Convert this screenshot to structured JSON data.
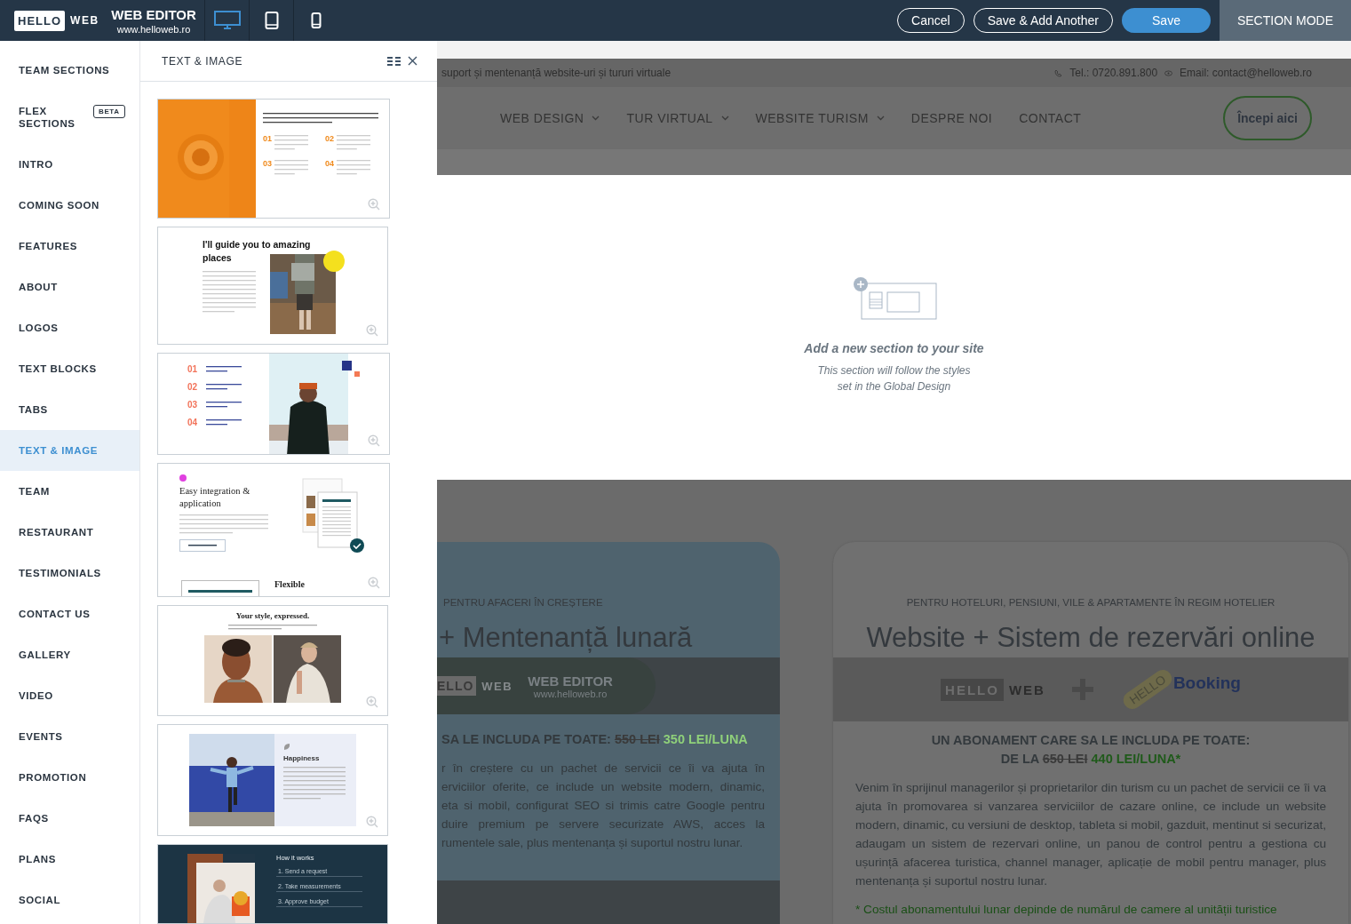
{
  "topbar": {
    "logo_hello": "HELLO",
    "logo_web": "WEB",
    "title": "WEB EDITOR",
    "url": "www.helloweb.ro",
    "devices": [
      {
        "kind": "desktop",
        "selected": true
      },
      {
        "kind": "tablet",
        "selected": false
      },
      {
        "kind": "phone",
        "selected": false
      }
    ],
    "buttons": [
      {
        "label": "Cancel",
        "kind": "outline"
      },
      {
        "label": "Save & Add Another",
        "kind": "outline"
      },
      {
        "label": "Save",
        "kind": "primary"
      }
    ],
    "mode": "SECTION MODE"
  },
  "sidebar": {
    "items": [
      {
        "label": "TEAM SECTIONS",
        "selected": false
      },
      {
        "label": "FLEX SECTIONS",
        "badge": "BETA",
        "selected": false
      },
      {
        "label": "INTRO",
        "selected": false
      },
      {
        "label": "COMING SOON",
        "selected": false
      },
      {
        "label": "FEATURES",
        "selected": false
      },
      {
        "label": "ABOUT",
        "selected": false
      },
      {
        "label": "LOGOS",
        "selected": false
      },
      {
        "label": "TEXT BLOCKS",
        "selected": false
      },
      {
        "label": "TABS",
        "selected": false
      },
      {
        "label": "TEXT & IMAGE",
        "selected": true
      },
      {
        "label": "TEAM",
        "selected": false
      },
      {
        "label": "RESTAURANT",
        "selected": false
      },
      {
        "label": "TESTIMONIALS",
        "selected": false
      },
      {
        "label": "CONTACT US",
        "selected": false
      },
      {
        "label": "GALLERY",
        "selected": false
      },
      {
        "label": "VIDEO",
        "selected": false
      },
      {
        "label": "EVENTS",
        "selected": false
      },
      {
        "label": "PROMOTION",
        "selected": false
      },
      {
        "label": "FAQS",
        "selected": false
      },
      {
        "label": "PLANS",
        "selected": false
      },
      {
        "label": "SOCIAL",
        "selected": false
      }
    ]
  },
  "panel": {
    "title": "TEXT & IMAGE",
    "templates": [
      {
        "kind": "numbered",
        "numbers": [
          "01",
          "02",
          "03",
          "04"
        ]
      },
      {
        "kind": "guide",
        "heading": "I'll guide you to amazing places"
      },
      {
        "kind": "values",
        "numbers": [
          "01",
          "02",
          "03",
          "04"
        ]
      },
      {
        "kind": "integration",
        "heading": "Easy integration & application",
        "subheading": "Flexible"
      },
      {
        "kind": "style",
        "heading": "Your style, expressed."
      },
      {
        "kind": "happiness",
        "heading": "Happiness"
      },
      {
        "kind": "how",
        "heading": "How it works",
        "steps": [
          "1. Send a request",
          "2. Take measurements",
          "3. Approve budget"
        ]
      }
    ]
  },
  "site": {
    "tagline": "suport și mentenanță website-uri și tururi virtuale",
    "phone": "Tel.: 0720.891.800",
    "email": "Email: contact@helloweb.ro",
    "nav": [
      {
        "label": "WEB DESIGN",
        "dropdown": true
      },
      {
        "label": "TUR VIRTUAL",
        "dropdown": true
      },
      {
        "label": "WEBSITE TURISM",
        "dropdown": true
      },
      {
        "label": "DESPRE NOI",
        "dropdown": false
      },
      {
        "label": "CONTACT",
        "dropdown": false
      }
    ],
    "cta": "Începi aici"
  },
  "empty_section": {
    "title": "Add a new section to your site",
    "lines": [
      "This section will follow the styles",
      "set in the Global Design"
    ]
  },
  "cards": [
    {
      "kind": "partial",
      "eyebrow": "PENTRU AFACERI ÎN CREȘTERE",
      "title": "+ Mentenanță lunară",
      "banner": {
        "kind": "editor",
        "hello": "ELLO",
        "web": "WEB",
        "title": "WEB EDITOR",
        "url": "www.helloweb.ro"
      },
      "lead": "SA LE INCLUDA PE TOATE:",
      "old_price": "550 LEI",
      "new_price": "350 LEI/LUNA",
      "body_lines": [
        "r în creștere cu un pachet de servicii ce îi va ajuta în",
        "erviciilor oferite, ce include un website modern, dinamic,",
        "eta si mobil, configurat SEO si trimis catre Google pentru",
        "duire premium pe servere securizate AWS, acces la",
        "rumentele sale, plus mentenanța și suportul nostru lunar."
      ]
    },
    {
      "kind": "full",
      "eyebrow": "PENTRU HOTELURI, PENSIUNI, VILE & APARTAMENTE ÎN REGIM HOTELIER",
      "title": "Website + Sistem de rezervări online",
      "banner": {
        "kind": "booking",
        "hello": "HELLO",
        "web": "WEB",
        "tag": "HELLO",
        "booking": "Booking"
      },
      "lead": "UN ABONAMENT CARE SA LE INCLUDA PE TOATE:",
      "prefix": "DE LA",
      "old_price": "650 LEI",
      "new_price": "440 LEI/LUNA*",
      "body": "Venim în sprijinul managerilor și proprietarilor din turism cu un pachet de servicii ce îi va ajuta în promovarea si vanzarea serviciilor de cazare online, ce include un website modern, dinamic, cu versiuni de desktop, tableta si mobil, gazduit, mentinut si securizat, adaugam un sistem de rezervari online, un panou de control pentru a gestiona cu ușurință afacerea turistica, channel manager, aplicație de mobil pentru manager, plus mentenanța și suportul nostru lunar.",
      "footnote": "* Costul abonamentului lunar depinde de numărul de camere al unității turistice"
    }
  ]
}
